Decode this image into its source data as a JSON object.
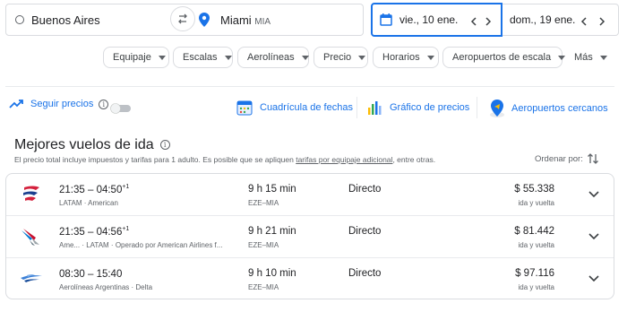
{
  "search": {
    "origin": "Buenos Aires",
    "destination": "Miami",
    "destination_code": "MIA",
    "depart_date": "vie., 10 ene.",
    "return_date": "dom., 19 ene."
  },
  "filters": [
    "Equipaje",
    "Escalas",
    "Aerolíneas",
    "Precio",
    "Horarios",
    "Aeropuertos de escala",
    "Más"
  ],
  "tools": {
    "track_prices": "Seguir precios",
    "date_grid": "Cuadrícula de fechas",
    "price_graph": "Gráfico de precios",
    "nearby_airports": "Aeropuertos cercanos"
  },
  "results": {
    "title": "Mejores vuelos de ida",
    "subtitle_pre": "El precio total incluye impuestos y tarifas para 1 adulto. Es posible que se apliquen ",
    "subtitle_link": "tarifas por equipaje adicional",
    "subtitle_post": ", entre otras.",
    "sort_label": "Ordenar por:",
    "flights": [
      {
        "time": "21:35 – 04:50",
        "plus_day": "+1",
        "airline": "LATAM  ·  American",
        "duration": "9 h 15 min",
        "route": "EZE–MIA",
        "stops": "Directo",
        "price": "$ 55.338",
        "price_type": "ida y vuelta"
      },
      {
        "time": "21:35 – 04:56",
        "plus_day": "+1",
        "airline": "Ame...  ·  LATAM  ·  Operado por American Airlines f...",
        "duration": "9 h 21 min",
        "route": "EZE–MIA",
        "stops": "Directo",
        "price": "$ 81.442",
        "price_type": "ida y vuelta"
      },
      {
        "time": "08:30 – 15:40",
        "plus_day": "",
        "airline": "Aerolíneas Argentinas  ·  Delta",
        "duration": "9 h 10 min",
        "route": "EZE–MIA",
        "stops": "Directo",
        "price": "$ 97.116",
        "price_type": "ida y vuelta"
      }
    ]
  },
  "colors": {
    "accent": "#1a73e8",
    "border": "#dadce0",
    "muted_text": "#5f6368",
    "latam": "#d4203c",
    "american_red": "#c8102e",
    "american_blue": "#0078d2",
    "aerolineas": "#3a7fd6"
  },
  "icons": {
    "origin": "origin-circle-icon",
    "swap": "swap-icon",
    "destination": "location-pin-icon",
    "calendar": "calendar-icon",
    "trend": "trend-line-icon",
    "info": "info-icon",
    "sort": "sort-icon",
    "expand": "chevron-down-icon"
  }
}
